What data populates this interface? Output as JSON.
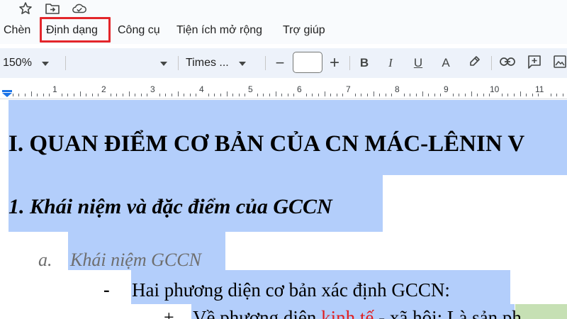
{
  "menu": {
    "insert": "Chèn",
    "format": "Định dạng",
    "tools": "Công cụ",
    "extensions": "Tiện ích mở rộng",
    "help": "Trợ giúp"
  },
  "toolbar": {
    "zoom": "150%",
    "font": "Times ...",
    "font_size": "",
    "minus": "−",
    "plus": "+",
    "bold": "B",
    "italic": "I",
    "underline": "U",
    "text_color": "A"
  },
  "ruler": {
    "numbers": [
      "1",
      "2",
      "3",
      "4",
      "5",
      "6",
      "7",
      "8",
      "9",
      "10",
      "11"
    ]
  },
  "document": {
    "heading1": "I. QUAN ĐIỂM CƠ BẢN CỦA CN MÁC-LÊNIN V",
    "heading2": "1. Khái niệm và đặc điểm của GCCN",
    "subheading_marker": "a.",
    "subheading": "Khái niệm GCCN",
    "bullet_marker": "-",
    "bullet_text": "Hai phương diện cơ bản xác định GCCN:",
    "line5_marker": "+",
    "line5_part1": "Về phương diện",
    "line5_red": "kinh tế",
    "line5_part2": " - xã hội: Là sản ph"
  },
  "colors": {
    "selection": "#b3cefb",
    "highlight_box": "#e3262b",
    "red_text": "#e11d1d",
    "green_highlight": "#c6e0b4"
  }
}
